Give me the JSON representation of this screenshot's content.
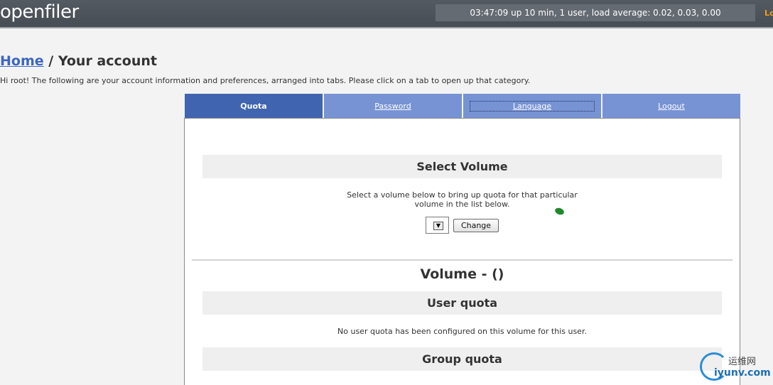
{
  "header": {
    "logo_text": "openfiler",
    "uptime": "03:47:09 up 10 min, 1 user, load average: 0.02, 0.03, 0.00",
    "logout_short": "Lo"
  },
  "breadcrumb": {
    "home": "Home",
    "separator": "/",
    "current": "Your account"
  },
  "intro": "Hi root! The following are your account information and preferences, arranged into tabs. Please click on a tab to open up that category.",
  "tabs": [
    {
      "label": "Quota",
      "active": true
    },
    {
      "label": "Password",
      "active": false
    },
    {
      "label": "Language",
      "active": false
    },
    {
      "label": "Logout",
      "active": false
    }
  ],
  "select_volume": {
    "title": "Select Volume",
    "description_line1": "Select a volume below to bring up quota for that particular",
    "description_line2": "volume in the list below.",
    "selected_value": "",
    "change_button": "Change"
  },
  "volume_title": "Volume - ()",
  "user_quota": {
    "title": "User quota",
    "message": "No user quota has been configured on this volume for this user."
  },
  "group_quota": {
    "title": "Group quota"
  },
  "watermark": {
    "cn": "运维网",
    "en": "iyunv.com"
  },
  "colors": {
    "header_bg": "#4d5359",
    "tab_active": "#4164b0",
    "tab_inactive": "#7793d4",
    "link": "#3b67c0"
  }
}
